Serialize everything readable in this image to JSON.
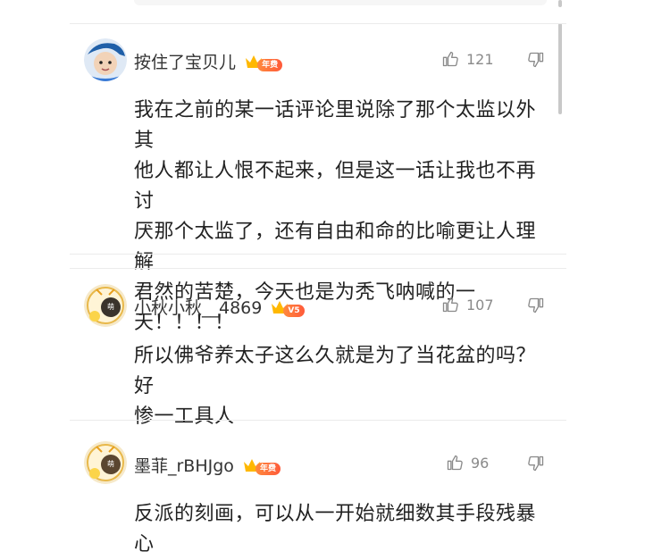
{
  "comments": [
    {
      "username": "按住了宝贝儿",
      "badge": "年费",
      "likes": "121",
      "text_lines": [
        "我在之前的某一话评论里说除了那个太监以外其",
        "他人都让人恨不起来，但是这一话让我也不再讨",
        "厌那个太监了，还有自由和命的比喻更让人理解",
        "君然的苦楚，今天也是为秃飞呐喊的一",
        "天！！！！"
      ]
    },
    {
      "username": "小秋小秋__4869",
      "badge": "V5",
      "likes": "107",
      "text_lines": [
        "所以佛爷养太子这么久就是为了当花盆的吗？好",
        "惨一工具人"
      ]
    },
    {
      "username": "墨菲_rBHJgo",
      "badge": "年费",
      "likes": "96",
      "text_lines": [
        "反派的刻画，可以从一开始就细数其手段残暴心"
      ]
    }
  ],
  "colors": {
    "badge": "#ff6a3a",
    "crown": "#ffb800",
    "muted": "#8a8a8a"
  },
  "icons": {
    "like": "thumbs-up-icon",
    "dislike": "thumbs-down-icon"
  }
}
